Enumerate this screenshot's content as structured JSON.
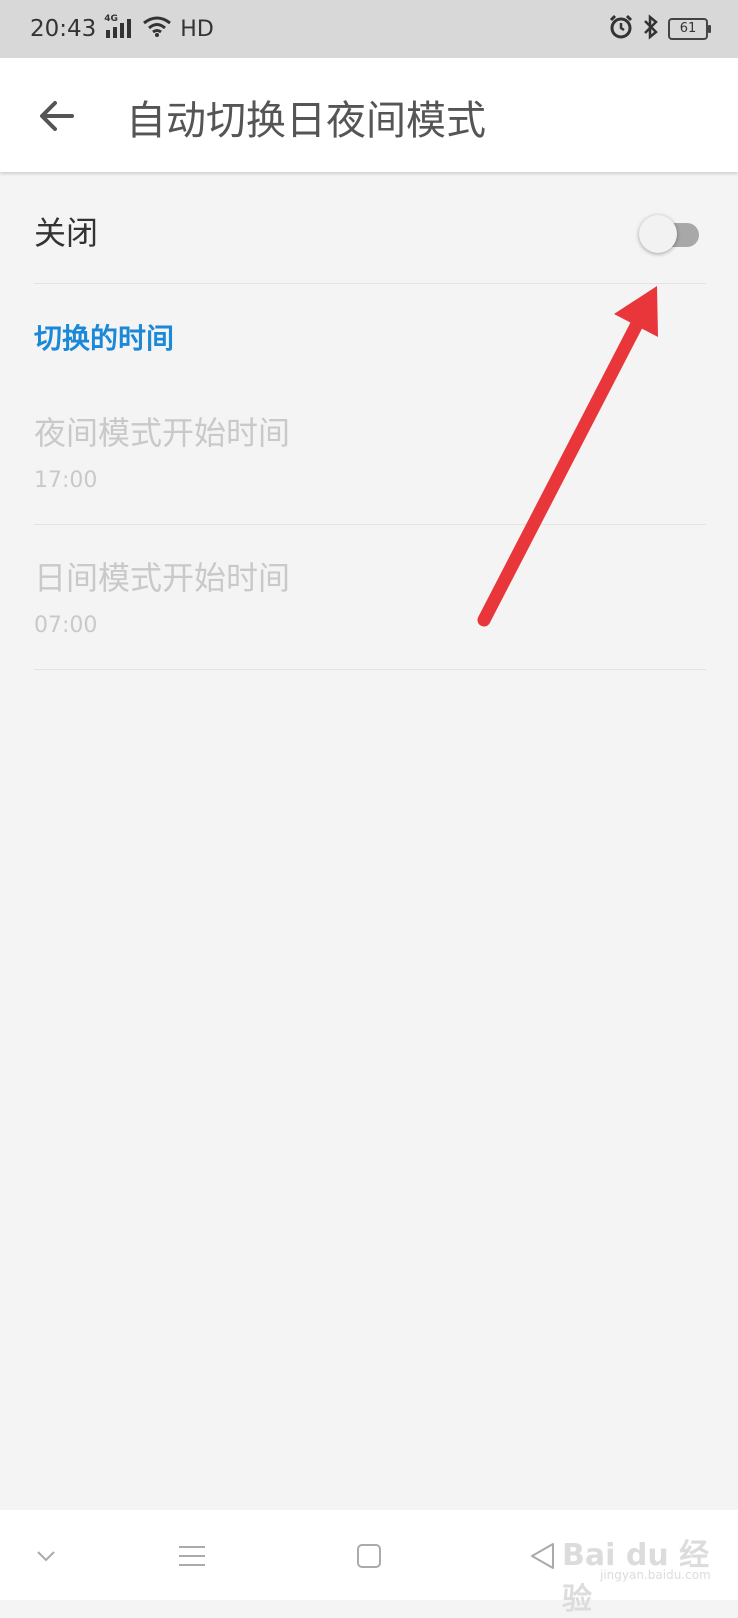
{
  "status_bar": {
    "time": "20:43",
    "network": "4G",
    "hd": "HD",
    "battery": "61"
  },
  "app_bar": {
    "title": "自动切换日夜间模式"
  },
  "switch_row": {
    "label": "关闭",
    "toggle_on": false
  },
  "section": {
    "header": "切换的时间"
  },
  "time_settings": [
    {
      "title": "夜间模式开始时间",
      "value": "17:00"
    },
    {
      "title": "日间模式开始时间",
      "value": "07:00"
    }
  ],
  "watermark": {
    "brand": "Bai du 经验",
    "url": "jingyan.baidu.com"
  },
  "colors": {
    "accent": "#1b88d8",
    "annotation_arrow": "#e8363a",
    "disabled_text": "#c9c9c9"
  }
}
